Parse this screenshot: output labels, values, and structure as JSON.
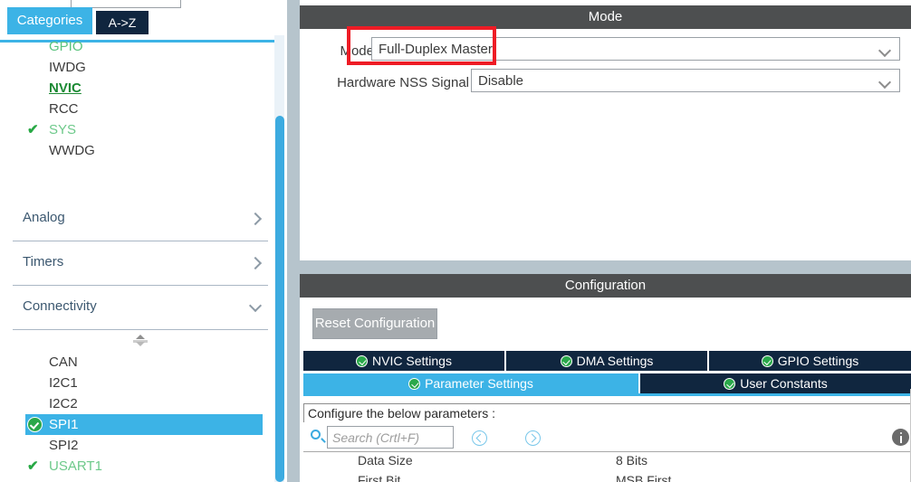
{
  "sidebar": {
    "tabs": [
      {
        "label": "Categories",
        "active": true
      },
      {
        "label": "A->Z",
        "active": false
      }
    ],
    "peripherals": [
      {
        "label": "GPIO",
        "state": "green"
      },
      {
        "label": "IWDG",
        "state": "plain"
      },
      {
        "label": "NVIC",
        "state": "active-link"
      },
      {
        "label": "RCC",
        "state": "plain"
      },
      {
        "label": "SYS",
        "state": "green-checked",
        "check": "✔"
      },
      {
        "label": "WWDG",
        "state": "plain"
      }
    ],
    "groups": [
      {
        "label": "Analog",
        "expanded": false,
        "chevron": "chevron-right-icon"
      },
      {
        "label": "Timers",
        "expanded": false,
        "chevron": "chevron-right-icon"
      },
      {
        "label": "Connectivity",
        "expanded": true,
        "chevron": "chevron-down-icon"
      }
    ],
    "connectivity_items": [
      {
        "label": "CAN",
        "state": "plain"
      },
      {
        "label": "I2C1",
        "state": "plain"
      },
      {
        "label": "I2C2",
        "state": "plain"
      },
      {
        "label": "SPI1",
        "state": "selected"
      },
      {
        "label": "SPI2",
        "state": "plain"
      },
      {
        "label": "USART1",
        "state": "green-checked",
        "check": "✔"
      }
    ]
  },
  "mode_panel": {
    "title": "Mode",
    "fields": [
      {
        "label": "Mode",
        "value": "Full-Duplex Master"
      },
      {
        "label": "Hardware NSS Signal",
        "value": "Disable"
      }
    ],
    "annotation_color": "#ee1c25"
  },
  "config_panel": {
    "title": "Configuration",
    "reset_label": "Reset Configuration",
    "tabs_row1": [
      {
        "label": "NVIC Settings",
        "active": false
      },
      {
        "label": "DMA Settings",
        "active": false
      },
      {
        "label": "GPIO Settings",
        "active": false
      }
    ],
    "tabs_row2": [
      {
        "label": "Parameter Settings",
        "active": true
      },
      {
        "label": "User Constants",
        "active": false
      }
    ],
    "note": "Configure the below parameters :",
    "search_placeholder": "Search (Crtl+F)",
    "search_value": "",
    "parameters": [
      {
        "key": "Data Size",
        "value": "8 Bits"
      },
      {
        "key": "First Bit",
        "value": "MSB First"
      }
    ]
  },
  "colors": {
    "accent_blue": "#3cb3e6",
    "dark_navy": "#10263f",
    "panel_header": "#4d4f50",
    "green_check": "#2aa84a",
    "annotation_red": "#ee1c25"
  }
}
